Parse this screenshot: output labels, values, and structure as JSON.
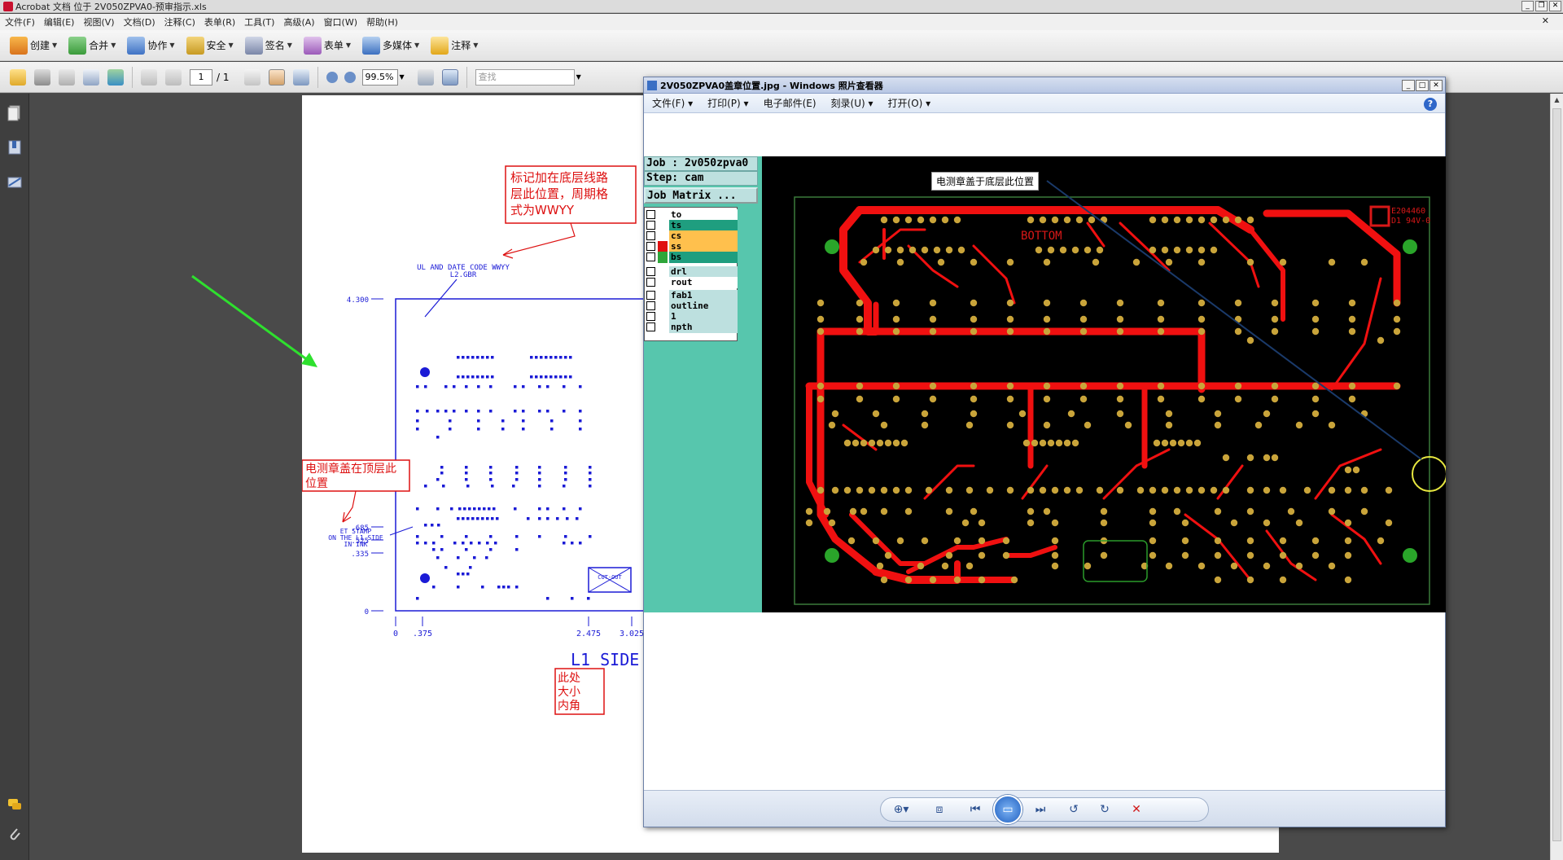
{
  "acrobat": {
    "title": "Acrobat 文档 位于 2V050ZPVA0-预审指示.xls",
    "menu": [
      "文件(F)",
      "编辑(E)",
      "视图(V)",
      "文档(D)",
      "注释(C)",
      "表单(R)",
      "工具(T)",
      "高级(A)",
      "窗口(W)",
      "帮助(H)"
    ],
    "toolbar": [
      {
        "label": "创建",
        "icon": "create-pdf-icon"
      },
      {
        "label": "合并",
        "icon": "combine-icon"
      },
      {
        "label": "协作",
        "icon": "collaborate-icon"
      },
      {
        "label": "安全",
        "icon": "lock-icon"
      },
      {
        "label": "签名",
        "icon": "pen-icon"
      },
      {
        "label": "表单",
        "icon": "form-icon"
      },
      {
        "label": "多媒体",
        "icon": "multimedia-icon"
      },
      {
        "label": "注释",
        "icon": "comment-icon"
      }
    ],
    "page_current": "1",
    "page_total": "/ 1",
    "zoom": "99.5%",
    "search_placeholder": "查找"
  },
  "drawing": {
    "note_top_label": "标记加在底层线路层此位置，周期格式为WWYY",
    "note_top_lines": [
      "标记加在底层线路",
      "层此位置，周期格",
      "式为WWYY"
    ],
    "note_left_lines": [
      "电测章盖在顶层此",
      "位置"
    ],
    "note_bottom_lines": [
      "此处",
      "大小",
      "内角"
    ],
    "ul_label": [
      "UL AND DATE CODE WWYY",
      "L2.GBR"
    ],
    "et_label": [
      "ET STAMP",
      "ON THE L1 SIDE",
      "IN INK"
    ],
    "y_ticks": [
      "4.300",
      ".685",
      ".525",
      ".335",
      "0"
    ],
    "x_ticks": [
      "0",
      ".375",
      "2.475",
      "3.025"
    ],
    "side_label": "L1 SIDE",
    "stamp_text": "CUT-OUT"
  },
  "viewer": {
    "title": "2V050ZPVA0盖章位置.jpg - Windows 照片查看器",
    "menu": [
      "文件(F)",
      "打印(P)",
      "电子邮件(E)",
      "刻录(U)",
      "打开(O)"
    ],
    "help": "?",
    "controls": [
      "zoom-icon",
      "fit-icon",
      "previous-icon",
      "slideshow-icon",
      "next-icon",
      "rotate-ccw-icon",
      "rotate-cw-icon",
      "delete-icon"
    ]
  },
  "cam": {
    "job": "Job : 2v050zpva0",
    "step": "Step: cam",
    "matrix": "Job Matrix ...",
    "layers": [
      {
        "name": "to",
        "color": "#ffffff",
        "swatch": "#ffffff"
      },
      {
        "name": "ts",
        "color": "#1f9e7f",
        "swatch": "#ffffff"
      },
      {
        "name": "cs",
        "color": "#ffc04d",
        "swatch": "#ffffff"
      },
      {
        "name": "ss",
        "color": "#ffc04d",
        "swatch": "#e01010"
      },
      {
        "name": "bs",
        "color": "#1f9e7f",
        "swatch": "#2ea63a"
      },
      {
        "name": "drl",
        "color": "#bde0df",
        "swatch": "#ffffff"
      },
      {
        "name": "rout",
        "color": "#ffffff",
        "swatch": "#ffffff"
      },
      {
        "name": "fab1",
        "color": "#bde0df",
        "swatch": "#ffffff"
      },
      {
        "name": "outline",
        "color": "#bde0df",
        "swatch": "#ffffff"
      },
      {
        "name": "1",
        "color": "#bde0df",
        "swatch": "#ffffff"
      },
      {
        "name": "npth",
        "color": "#bde0df",
        "swatch": "#ffffff"
      }
    ],
    "board_callout": "电测章盖于底层此位置",
    "board_text": "BOTTOM",
    "board_marks": [
      "E204460",
      "D1 94V-0"
    ]
  }
}
